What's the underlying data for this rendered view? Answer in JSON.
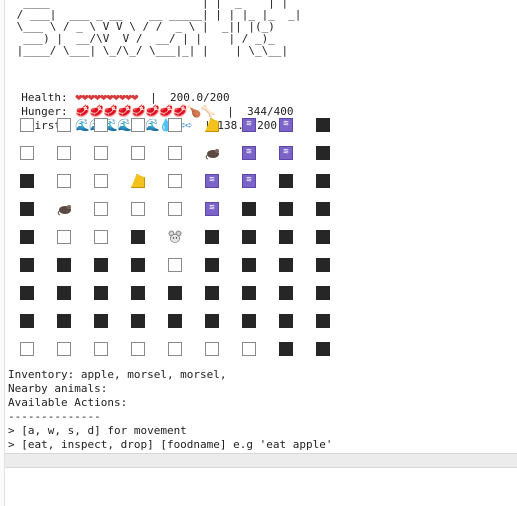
{
  "banner": "  ____                       | |  _    | |\n / ___|  ___ _ __    __ _____| | | |_ |_  _|\n \\___ \\ / _ \\ V V \\ / /  _ \\ |  _|| |(_)\n  ___) |  __/\\V  V /  __/ | |    | / _)_\n |____/ \\___| \\_/\\_/ \\___|_| |    | \\_\\__|",
  "stats": [
    {
      "label": "Health:",
      "icons": "❤❤❤❤❤❤❤❤❤❤",
      "value": "200.0/200",
      "color": "#d63a3a"
    },
    {
      "label": "Hunger:",
      "icons": "🥩🥩🥩🥩🥩🥩🥩🥩🍗🦴",
      "value": "344/400",
      "color": "#c0392b"
    },
    {
      "label": "Thirst:",
      "icons": "🌊🌊🌊🌊🌊🌊💧➪➪➪",
      "value": "138.0/200",
      "color": "#2e86de"
    }
  ],
  "grid": [
    [
      "empty",
      "empty",
      "empty",
      "empty",
      "empty",
      "cheese",
      "water",
      "water",
      "black"
    ],
    [
      "empty",
      "empty",
      "empty",
      "empty",
      "empty",
      "rat",
      "water",
      "water",
      "black"
    ],
    [
      "black",
      "empty",
      "empty",
      "cheese",
      "empty",
      "water",
      "water",
      "black",
      "black"
    ],
    [
      "black",
      "rat",
      "empty",
      "empty",
      "empty",
      "water",
      "black",
      "black",
      "black"
    ],
    [
      "black",
      "empty",
      "empty",
      "black",
      "mouse",
      "black",
      "black",
      "black",
      "black"
    ],
    [
      "black",
      "black",
      "black",
      "black",
      "empty",
      "black",
      "black",
      "black",
      "black"
    ],
    [
      "black",
      "black",
      "black",
      "black",
      "black",
      "black",
      "black",
      "black",
      "black"
    ],
    [
      "black",
      "black",
      "black",
      "black",
      "black",
      "black",
      "black",
      "black",
      "black"
    ],
    [
      "empty",
      "empty",
      "empty",
      "empty",
      "empty",
      "empty",
      "empty",
      "black",
      "black"
    ]
  ],
  "lines": {
    "inventory": "Inventory: apple, morsel, morsel,",
    "nearby": "Nearby animals:",
    "actions": "Available Actions:",
    "divider": "--------------",
    "movement": "> [a, w, s, d] for movement",
    "commands": "> [eat, inspect, drop] [foodname] e.g 'eat apple'"
  }
}
